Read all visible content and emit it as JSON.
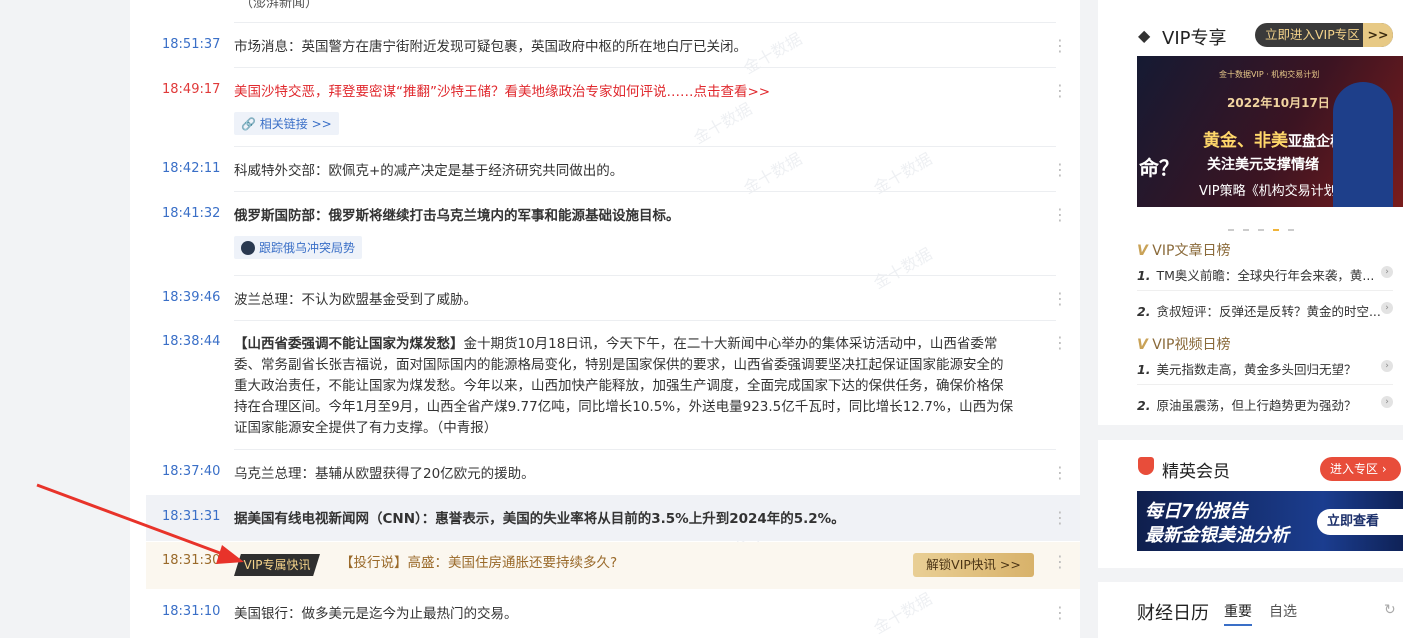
{
  "feed": {
    "top_source": "（澎湃新闻）",
    "items": [
      {
        "time": "18:51:37",
        "text": "市场消息：英国警方在唐宁街附近发现可疑包裹，英国政府中枢的所在地白厅已关闭。"
      },
      {
        "time": "18:49:17",
        "text": "美国沙特交恶，拜登要密谋“推翻”沙特王储？看美地缘政治专家如何评说……点击查看>>",
        "tag": "相关链接 >>"
      },
      {
        "time": "18:42:11",
        "text": "科威特外交部：欧佩克+的减产决定是基于经济研究共同做出的。"
      },
      {
        "time": "18:41:32",
        "text": "俄罗斯国防部：俄罗斯将继续打击乌克兰境内的军事和能源基础设施目标。",
        "tag": "跟踪俄乌冲突局势"
      },
      {
        "time": "18:39:46",
        "text": "波兰总理：不认为欧盟基金受到了威胁。"
      },
      {
        "time": "18:38:44",
        "headline": "【山西省委强调不能让国家为煤发愁】",
        "lines": [
          "金十期货10月18日讯，今天下午，在二十大新闻中心举办的集体采访活动中，山西省委常",
          "委、常务副省长张吉福说，面对国际国内的能源格局变化，特别是国家保供的要求，山西省委强调要坚决扛起保证国家能源安全的",
          "重大政治责任，不能让国家为煤发愁。今年以来，山西加快产能释放，加强生产调度，全面完成国家下达的保供任务，确保价格保",
          "持在合理区间。今年1月至9月，山西全省产煤9.77亿吨，同比增长10.5%，外送电量923.5亿千瓦时，同比增长12.7%，山西为保",
          "证国家能源安全提供了有力支撑。（中青报）"
        ]
      },
      {
        "time": "18:37:40",
        "text": "乌克兰总理：基辅从欧盟获得了20亿欧元的援助。"
      },
      {
        "time": "18:31:31",
        "text": "据美国有线电视新闻网（CNN）：惠誉表示，美国的失业率将从目前的3.5%上升到2024年的5.2%。"
      },
      {
        "time": "18:31:30",
        "badge": "VIP专属快讯",
        "text": "【投行说】高盛：美国住房通胀还要持续多久?",
        "button": "解锁VIP快讯 >>"
      },
      {
        "time": "18:31:10",
        "text": "美国银行：做多美元是迄今为止最热门的交易。"
      }
    ],
    "watermark": "金十数据"
  },
  "sidebar": {
    "vip": {
      "title": "VIP专享",
      "enter": "立即进入VIP专区",
      "arrow": ">>",
      "banner": {
        "top": "金十数据VIP · 机构交易计划",
        "date": "2022年10月17日",
        "line1a": "黄金、非美",
        "line1b": "亚盘企稳",
        "line2": "关注美元支撑情绪",
        "line3": "VIP策略《机构交易计划》",
        "left": "命？"
      }
    },
    "article_rank": {
      "title": "VIP文章日榜",
      "items": [
        {
          "n": "1.",
          "text": "TM奥义前瞻：全球央行年会来袭，黄..."
        },
        {
          "n": "2.",
          "text": "贪叔短评：反弹还是反转？黄金的时空..."
        }
      ]
    },
    "video_rank": {
      "title": "VIP视频日榜",
      "items": [
        {
          "n": "1.",
          "text": "美元指数走高，黄金多头回归无望？"
        },
        {
          "n": "2.",
          "text": "原油虽震荡，但上行趋势更为强劲？"
        }
      ]
    },
    "elite": {
      "title": "精英会员",
      "button": "进入专区",
      "banner_line1": "每日7份报告",
      "banner_line2": "最新金银美油分析",
      "banner_btn": "立即查看"
    },
    "calendar": {
      "title": "财经日历",
      "tabs": [
        "重要",
        "自选"
      ]
    }
  },
  "colors": {
    "time": "#3a6fc7",
    "red": "#e0292e",
    "vip_gold": "#d8b26a",
    "elite_red": "#e84d3a"
  }
}
